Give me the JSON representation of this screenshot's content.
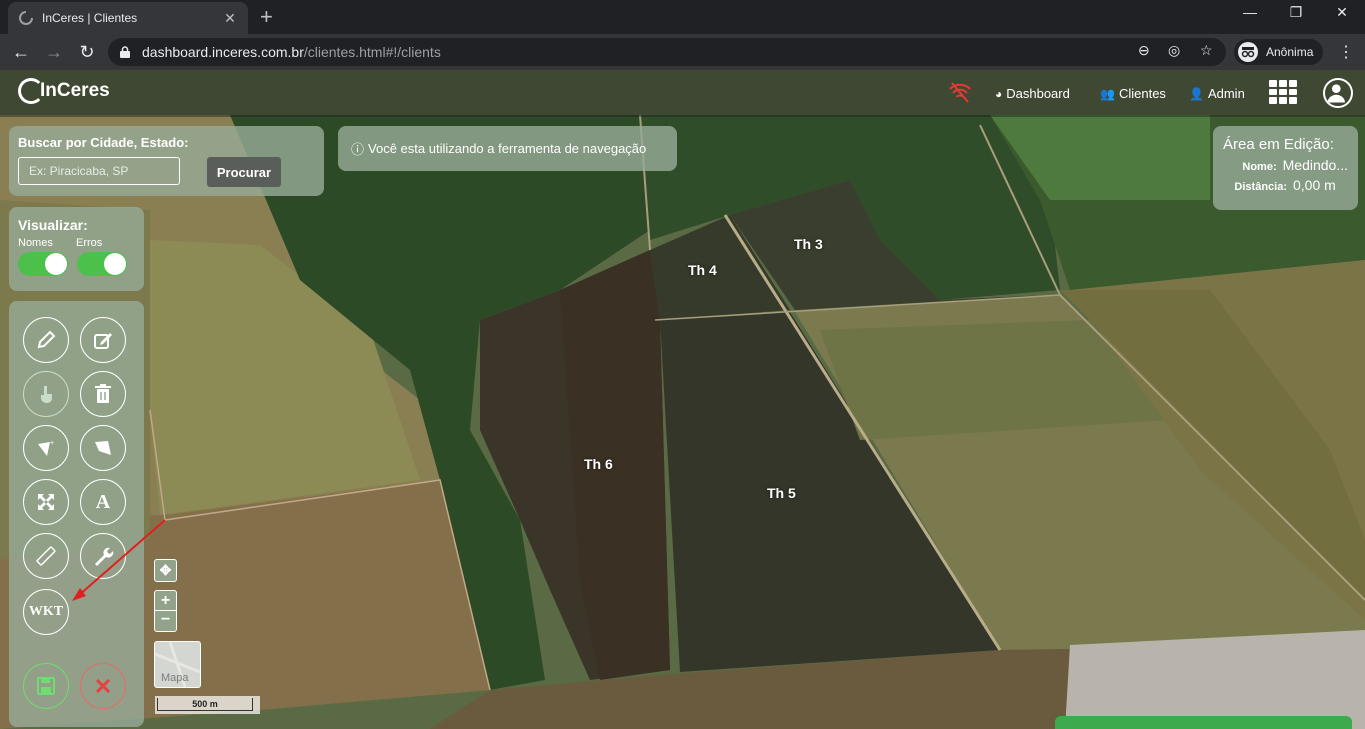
{
  "browser": {
    "tab_title": "InCeres | Clientes",
    "url_host": "dashboard.inceres.com.br",
    "url_path": "/clientes.html#!/clients",
    "profile_label": "Anônima"
  },
  "header": {
    "logo_text": "InCeres",
    "nav": [
      {
        "label": "Dashboard",
        "icon": "tachometer-icon"
      },
      {
        "label": "Clientes",
        "icon": "users-icon"
      },
      {
        "label": "Admin",
        "icon": "user-plus-icon"
      }
    ],
    "status_icon": "wifi-off-icon",
    "status_color": "#e53935"
  },
  "search": {
    "label": "Buscar por Cidade, Estado:",
    "placeholder": "Ex: Piracicaba, SP",
    "button_label": "Procurar"
  },
  "info_message": "Você esta utilizando a ferramenta de navegação",
  "edit_area": {
    "title": "Área em Edição:",
    "name_key": "Nome:",
    "name_value": "Medindo...",
    "distance_key": "Distância:",
    "distance_value": "0,00 m"
  },
  "view": {
    "title": "Visualizar:",
    "toggles": [
      {
        "label": "Nomes",
        "on": true
      },
      {
        "label": "Erros",
        "on": true
      }
    ]
  },
  "tools": [
    {
      "name": "pencil-icon"
    },
    {
      "name": "edit-icon"
    },
    {
      "name": "hand-pointer-icon"
    },
    {
      "name": "trash-icon"
    },
    {
      "name": "polygon-add-icon"
    },
    {
      "name": "polygon-icon"
    },
    {
      "name": "expand-icon"
    },
    {
      "name": "font-icon"
    },
    {
      "name": "ruler-icon"
    },
    {
      "name": "wrench-icon"
    },
    {
      "name": "wkt-icon"
    },
    {
      "name": "save-icon"
    },
    {
      "name": "cancel-icon"
    }
  ],
  "tool_labels": {
    "font": "A",
    "wkt": "WKT"
  },
  "map_controls": {
    "zoom_in": "+",
    "zoom_out": "−",
    "map_type_label": "Mapa",
    "scale_label": "500 m"
  },
  "fields": [
    {
      "label": "Th 3"
    },
    {
      "label": "Th 4"
    },
    {
      "label": "Th 6"
    },
    {
      "label": "Th 5"
    }
  ],
  "colors": {
    "toggle_on": "#4bc14b",
    "save": "#6fdc6f",
    "cancel": "#e86a6a",
    "annotation_arrow": "#e02020"
  }
}
